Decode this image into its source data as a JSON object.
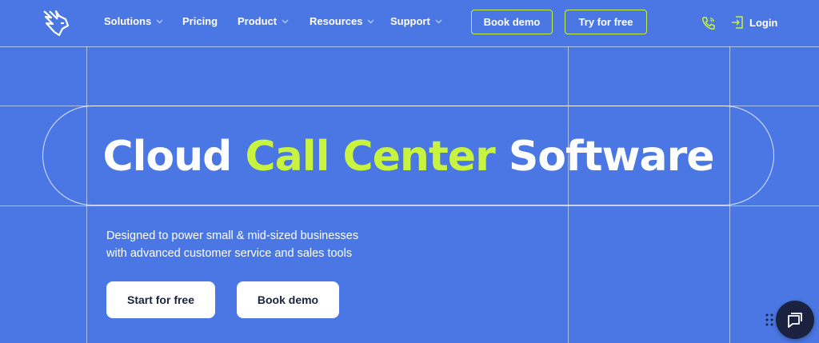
{
  "nav": {
    "items": [
      {
        "label": "Solutions",
        "has_dropdown": true
      },
      {
        "label": "Pricing",
        "has_dropdown": false
      },
      {
        "label": "Product",
        "has_dropdown": true
      },
      {
        "label": "Resources",
        "has_dropdown": true
      },
      {
        "label": "Support",
        "has_dropdown": true
      }
    ],
    "book_demo": "Book demo",
    "try_free": "Try for free",
    "login": "Login",
    "icons": {
      "logo": "lion-logo-icon",
      "phone": "phone-icon",
      "login": "login-icon",
      "chevron": "chevron-down-icon"
    }
  },
  "hero": {
    "headline_part1": "Cloud ",
    "headline_accent": "Call Center",
    "headline_part2": " Software",
    "subtitle_line1": "Designed to power small & mid-sized businesses",
    "subtitle_line2": "with advanced customer service and sales tools",
    "cta_primary": "Start for free",
    "cta_secondary": "Book demo"
  },
  "chat": {
    "icon": "chat-icon",
    "handle_icon": "drag-handle-icon"
  },
  "colors": {
    "background": "#4a77e3",
    "accent": "#c8f33e",
    "dark": "#1a2240"
  }
}
